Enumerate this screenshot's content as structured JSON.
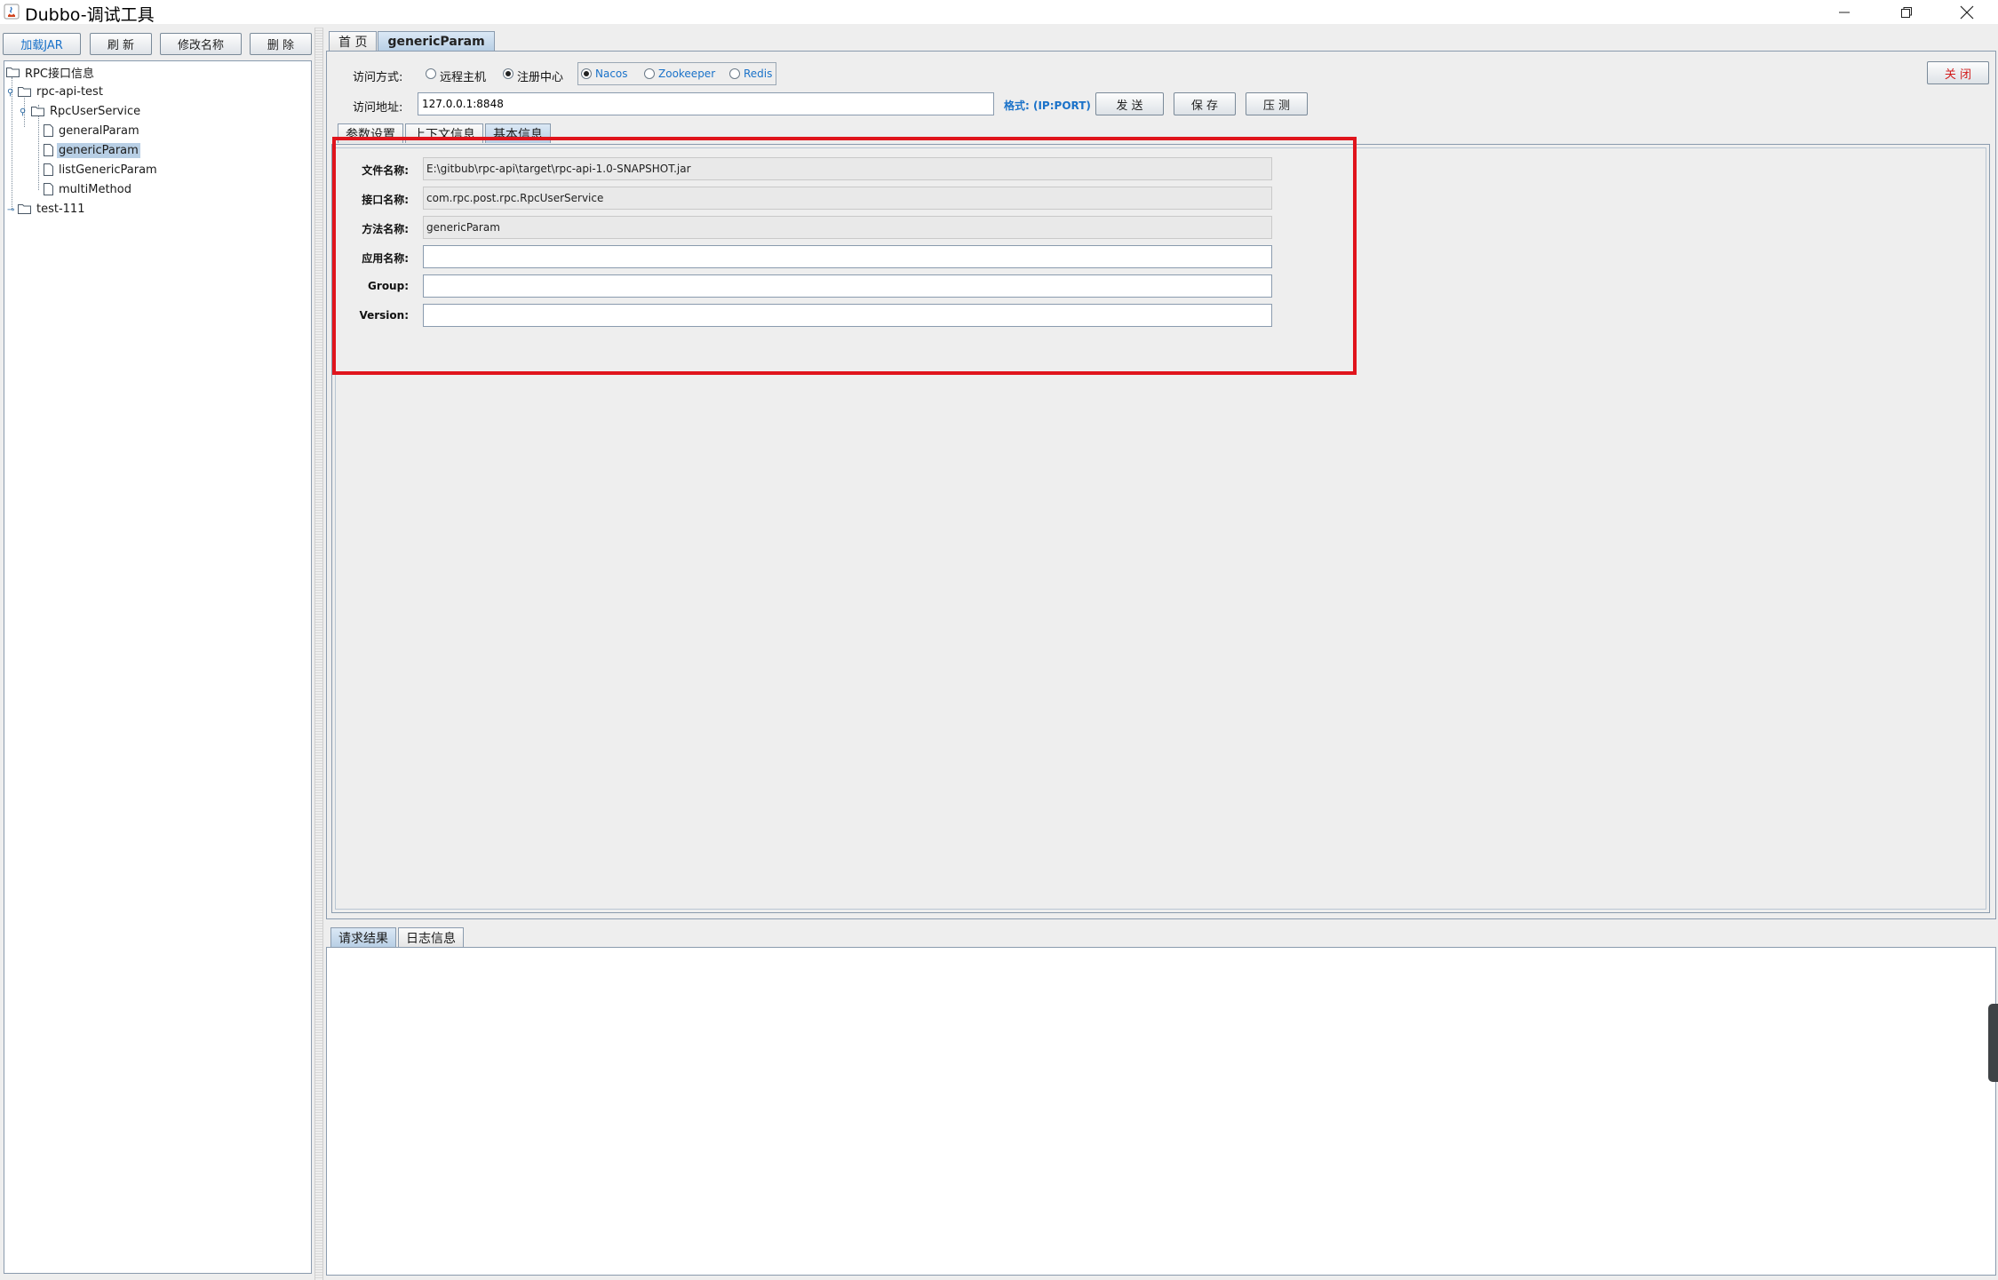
{
  "window": {
    "title": "Dubbo-调试工具"
  },
  "left_toolbar": {
    "load_jar": "加载JAR",
    "refresh": "刷 新",
    "rename": "修改名称",
    "delete": "删 除"
  },
  "tree": {
    "root": "RPC接口信息",
    "project": "rpc-api-test",
    "service": "RpcUserService",
    "methods": [
      "generalParam",
      "genericParam",
      "listGenericParam",
      "multiMethod"
    ],
    "project2": "test-111"
  },
  "main_tabs": [
    "首 页",
    "genericParam"
  ],
  "access": {
    "mode_label": "访问方式:",
    "mode_remote": "远程主机",
    "mode_registry": "注册中心",
    "selected_mode": "注册中心",
    "registry_options": [
      "Nacos",
      "Zookeeper",
      "Redis"
    ],
    "selected_registry": "Nacos",
    "address_label": "访问地址:",
    "address_value": "127.0.0.1:8848",
    "format_hint": "格式: (IP:PORT)"
  },
  "actions": {
    "send": "发 送",
    "save": "保 存",
    "stress": "压 测",
    "close": "关 闭"
  },
  "inner_tabs": [
    "参数设置",
    "上下文信息",
    "基本信息"
  ],
  "basic_info": {
    "fields": [
      {
        "label": "文件名称:",
        "value": "E:\\gitbub\\rpc-api\\target\\rpc-api-1.0-SNAPSHOT.jar"
      },
      {
        "label": "接口名称:",
        "value": "com.rpc.post.rpc.RpcUserService"
      },
      {
        "label": "方法名称:",
        "value": "genericParam"
      },
      {
        "label": "应用名称:",
        "value": ""
      },
      {
        "label": "Group:",
        "value": ""
      },
      {
        "label": "Version:",
        "value": ""
      }
    ]
  },
  "bottom_tabs": [
    "请求结果",
    "日志信息"
  ],
  "colors": {
    "accent_blue": "#1a72c9",
    "highlight_red": "#e0141c",
    "close_red": "#d11c1c",
    "tab_active": "#b8cfe5"
  }
}
